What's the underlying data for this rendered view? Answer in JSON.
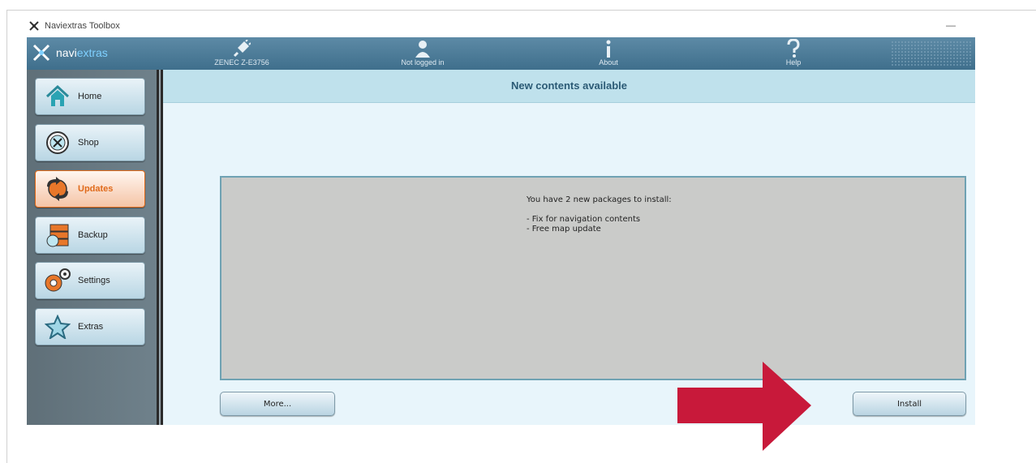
{
  "window": {
    "title": "Naviextras Toolbox",
    "minimize": "—"
  },
  "topbar": {
    "logo_navi": "navi",
    "logo_extras": "extras",
    "items": [
      {
        "label": "ZENEC Z-E3756",
        "icon": "plug-icon"
      },
      {
        "label": "Not logged in",
        "icon": "user-icon"
      },
      {
        "label": "About",
        "icon": "info-icon"
      },
      {
        "label": "Help",
        "icon": "help-icon"
      }
    ]
  },
  "sidebar": {
    "items": [
      {
        "label": "Home",
        "icon": "home-icon"
      },
      {
        "label": "Shop",
        "icon": "shop-icon"
      },
      {
        "label": "Updates",
        "icon": "updates-icon",
        "active": true
      },
      {
        "label": "Backup",
        "icon": "backup-icon"
      },
      {
        "label": "Settings",
        "icon": "settings-icon"
      },
      {
        "label": "Extras",
        "icon": "star-icon"
      }
    ]
  },
  "main": {
    "header": "New contents available",
    "message": "You have 2 new packages to install:",
    "packages": [
      "-  Fix for navigation contents",
      "-  Free map update"
    ],
    "more_button": "More...",
    "install_button": "Install"
  },
  "colors": {
    "accent": "#e06a1a",
    "arrow": "#c8193a",
    "header_bg": "#bfe1ec"
  }
}
